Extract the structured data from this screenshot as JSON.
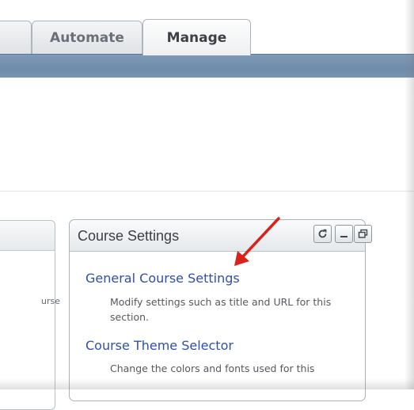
{
  "tabs": {
    "automate_label": "Automate",
    "manage_label": "Manage"
  },
  "left_portlet": {
    "text_fragment": "urse"
  },
  "course_settings": {
    "title": "Course Settings",
    "controls": [
      "refresh-icon",
      "minimize-icon",
      "restore-icon"
    ],
    "items": [
      {
        "link": "General Course Settings",
        "description": "Modify settings such as title and URL for this section."
      },
      {
        "link": "Course Theme Selector",
        "description": "Change the colors and fonts used for this"
      }
    ]
  },
  "annotation": {
    "arrow_color": "#d9231a"
  },
  "colors": {
    "nav_band": "#7591ad",
    "link": "#2f50a8"
  }
}
